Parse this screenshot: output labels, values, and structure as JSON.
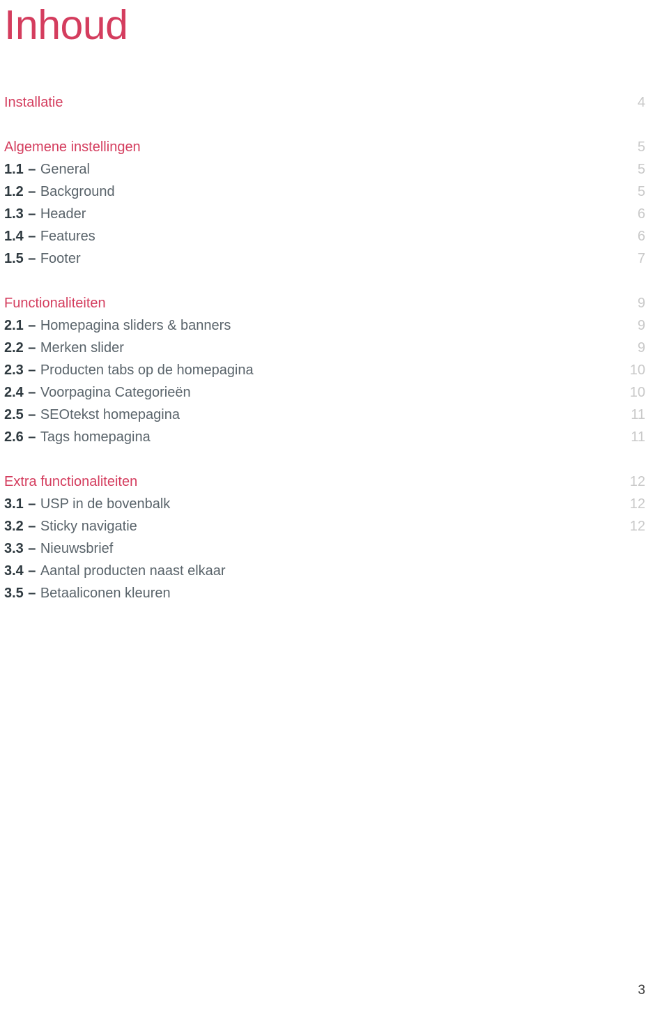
{
  "document": {
    "title": "Inhoud",
    "folio": "3",
    "accent_color": "#d43d5e",
    "label_color": "#5a646b",
    "number_color": "#2f3a40",
    "pageno_color": "#c9c9c9"
  },
  "toc": {
    "sections": [
      {
        "heading": {
          "label": "Installatie",
          "page": "4"
        },
        "entries": []
      },
      {
        "heading": {
          "label": "Algemene instellingen",
          "page": "5"
        },
        "entries": [
          {
            "num": "1.1",
            "dash": "–",
            "label": "General",
            "page": "5"
          },
          {
            "num": "1.2",
            "dash": "–",
            "label": "Background",
            "page": "5"
          },
          {
            "num": "1.3",
            "dash": "–",
            "label": "Header",
            "page": "6"
          },
          {
            "num": "1.4",
            "dash": "–",
            "label": "Features",
            "page": "6"
          },
          {
            "num": "1.5",
            "dash": "–",
            "label": "Footer",
            "page": "7"
          }
        ]
      },
      {
        "heading": {
          "label": "Functionaliteiten",
          "page": "9"
        },
        "entries": [
          {
            "num": "2.1",
            "dash": "–",
            "label": "Homepagina sliders & banners",
            "page": "9"
          },
          {
            "num": "2.2",
            "dash": "–",
            "label": "Merken slider",
            "page": "9"
          },
          {
            "num": "2.3",
            "dash": "–",
            "label": "Producten tabs op de homepagina",
            "page": "10"
          },
          {
            "num": "2.4",
            "dash": "–",
            "label": "Voorpagina Categorieën",
            "page": "10"
          },
          {
            "num": "2.5",
            "dash": "–",
            "label": "SEOtekst homepagina",
            "page": "11"
          },
          {
            "num": "2.6",
            "dash": "–",
            "label": "Tags homepagina",
            "page": "11"
          }
        ]
      },
      {
        "heading": {
          "label": "Extra functionaliteiten",
          "page": "12"
        },
        "entries": [
          {
            "num": "3.1",
            "dash": "–",
            "label": "USP in de bovenbalk",
            "page": "12"
          },
          {
            "num": "3.2",
            "dash": "–",
            "label": "Sticky navigatie",
            "page": "12"
          },
          {
            "num": "3.3",
            "dash": "–",
            "label": "Nieuwsbrief",
            "page": ""
          },
          {
            "num": "3.4",
            "dash": "–",
            "label": "Aantal producten naast elkaar",
            "page": ""
          },
          {
            "num": "3.5",
            "dash": "–",
            "label": "Betaaliconen kleuren",
            "page": ""
          }
        ]
      }
    ]
  }
}
